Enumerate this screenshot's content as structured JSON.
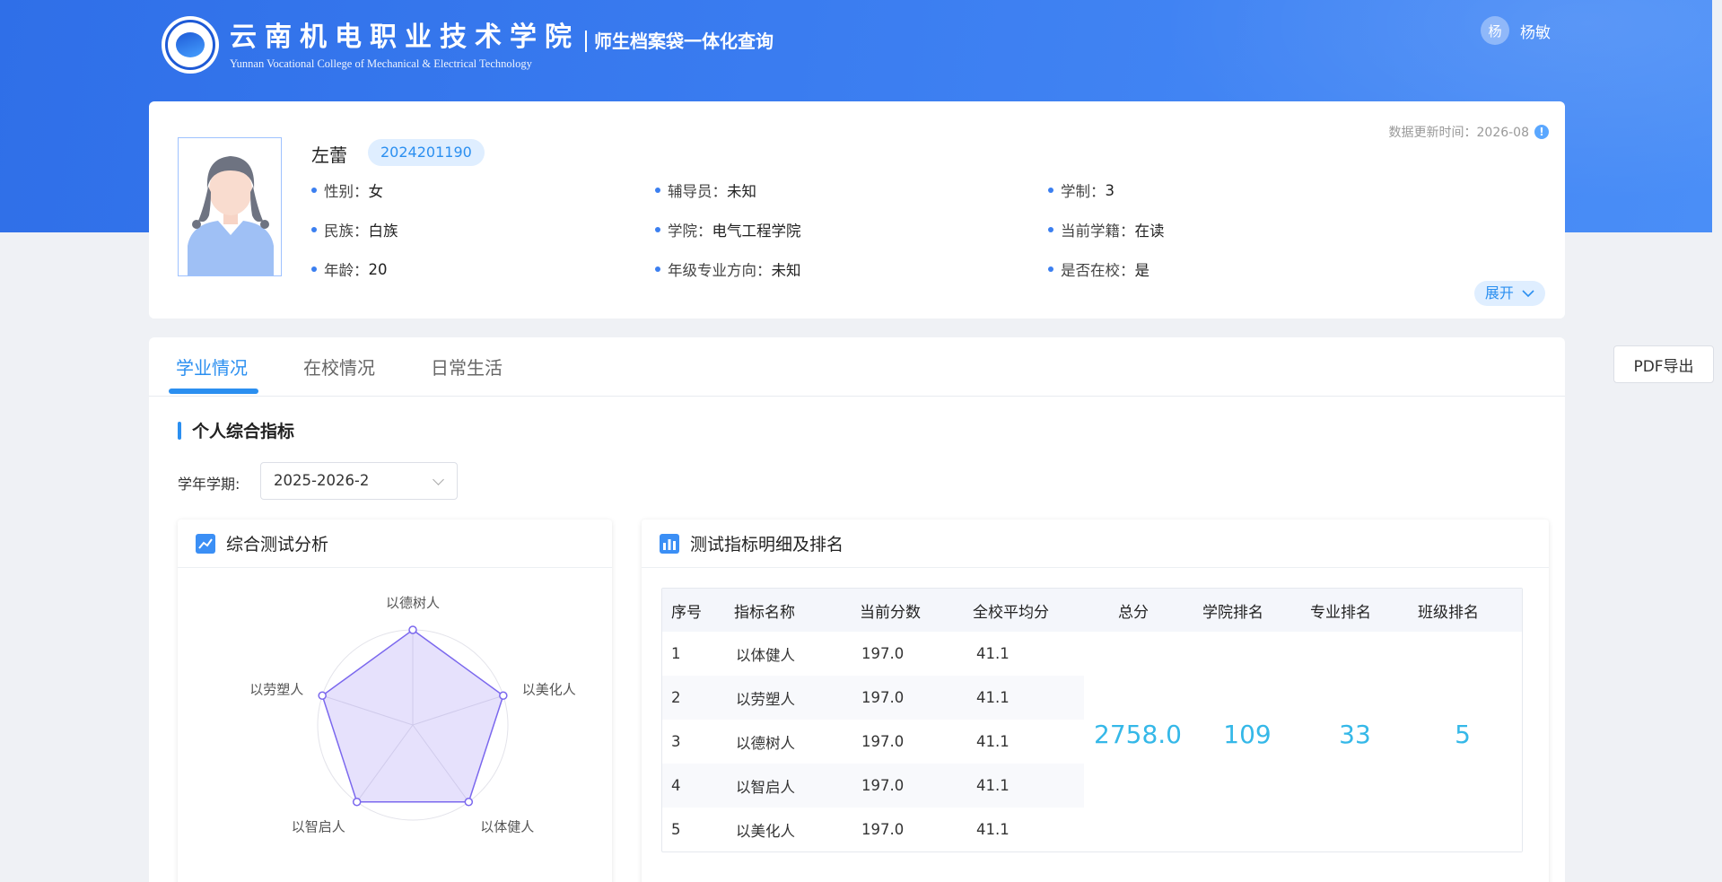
{
  "header": {
    "school_cn": "云南机电职业技术学院",
    "school_en": "Yunnan Vocational College of Mechanical & Electrical Technology",
    "system_title": "师生档案袋一体化查询",
    "user_avatar": "杨",
    "user_name": "杨敏",
    "header_color": "#3a7cf0"
  },
  "profile": {
    "name": "左蕾",
    "student_id": "2024201190",
    "update_time": "数据更新时间：2026-08",
    "expand_label": "展开",
    "fields": [
      {
        "label": "性别：",
        "value": "女"
      },
      {
        "label": "辅导员：",
        "value": "未知"
      },
      {
        "label": "学制：",
        "value": "3"
      },
      {
        "label": "民族：",
        "value": "白族"
      },
      {
        "label": "学院：",
        "value": "电气工程学院"
      },
      {
        "label": "当前学籍：",
        "value": "在读"
      },
      {
        "label": "年龄：",
        "value": "20"
      },
      {
        "label": "年级专业方向：",
        "value": "未知"
      },
      {
        "label": "是否在校：",
        "value": "是"
      }
    ]
  },
  "toolbar": {
    "pdf_export": "PDF导出"
  },
  "tabs": [
    {
      "label": "学业情况",
      "active": true
    },
    {
      "label": "在校情况",
      "active": false
    },
    {
      "label": "日常生活",
      "active": false
    }
  ],
  "section": {
    "title": "个人综合指标",
    "term_label": "学年学期:",
    "term_value": "2025-2026-2"
  },
  "radar_panel": {
    "title": "综合测试分析"
  },
  "chart_data": {
    "type": "radar",
    "axes": [
      "以德树人",
      "以美化人",
      "以体健人",
      "以智启人",
      "以劳塑人"
    ],
    "values": [
      197.0,
      197.0,
      197.0,
      197.0,
      197.0
    ],
    "series_color": "#7b68ee"
  },
  "table_panel": {
    "title": "测试指标明细及排名",
    "columns": [
      "序号",
      "指标名称",
      "当前分数",
      "全校平均分",
      "总分",
      "学院排名",
      "专业排名",
      "班级排名"
    ],
    "rows": [
      [
        "1",
        "以体健人",
        "197.0",
        "41.1"
      ],
      [
        "2",
        "以劳塑人",
        "197.0",
        "41.1"
      ],
      [
        "3",
        "以德树人",
        "197.0",
        "41.1"
      ],
      [
        "4",
        "以智启人",
        "197.0",
        "41.1"
      ],
      [
        "5",
        "以美化人",
        "197.0",
        "41.1"
      ]
    ],
    "total_score": "2758.0",
    "college_rank": "109",
    "major_rank": "33",
    "class_rank": "5"
  }
}
